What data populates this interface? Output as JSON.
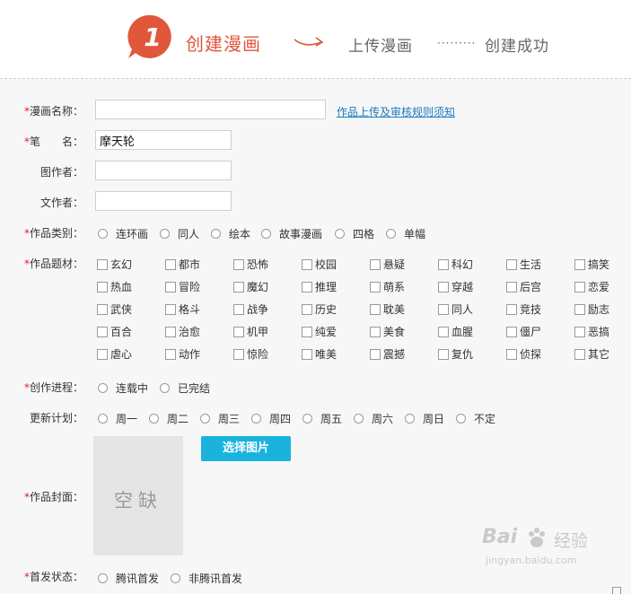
{
  "header": {
    "step_number": "1",
    "step1": "创建漫画",
    "step2": "上传漫画",
    "dots": "·········",
    "step3": "创建成功"
  },
  "form": {
    "required_mark": "*",
    "title_label": "漫画名称：",
    "title_value": "",
    "rules_link": "作品上传及审核规则须知",
    "penname_label": "笔　　名：",
    "penname_value": "摩天轮",
    "artist_label": "图作者：",
    "artist_value": "",
    "writer_label": "文作者：",
    "writer_value": "",
    "category_label": "作品类别：",
    "category_options": [
      "连环画",
      "同人",
      "绘本",
      "故事漫画",
      "四格",
      "单幅"
    ],
    "theme_label": "作品题材：",
    "theme_options": [
      [
        "玄幻",
        "都市",
        "恐怖",
        "校园",
        "悬疑",
        "科幻",
        "生活",
        "搞笑"
      ],
      [
        "热血",
        "冒险",
        "魔幻",
        "推理",
        "萌系",
        "穿越",
        "后宫",
        "恋爱"
      ],
      [
        "武侠",
        "格斗",
        "战争",
        "历史",
        "耽美",
        "同人",
        "竞技",
        "励志"
      ],
      [
        "百合",
        "治愈",
        "机甲",
        "纯爱",
        "美食",
        "血腥",
        "僵尸",
        "恶搞"
      ],
      [
        "虐心",
        "动作",
        "惊险",
        "唯美",
        "震撼",
        "复仇",
        "侦探",
        "其它"
      ]
    ],
    "progress_label": "创作进程：",
    "progress_options": [
      "连载中",
      "已完结"
    ],
    "schedule_label": "更新计划：",
    "schedule_options": [
      "周一",
      "周二",
      "周三",
      "周四",
      "周五",
      "周六",
      "周日",
      "不定"
    ],
    "cover_label": "作品封面：",
    "cover_placeholder": "空缺",
    "select_image_button": "选择图片",
    "first_release_label": "首发状态：",
    "first_release_options": [
      "腾讯首发",
      "非腾讯首发"
    ]
  },
  "watermark": {
    "logo_left": "Bai",
    "logo_right": "经验",
    "url": "jingyan.baidu.com"
  },
  "colors": {
    "accent_red": "#e0573c",
    "required_red": "#e0202a",
    "button_blue": "#1ab3dd",
    "link_blue": "#1a7ac0"
  }
}
